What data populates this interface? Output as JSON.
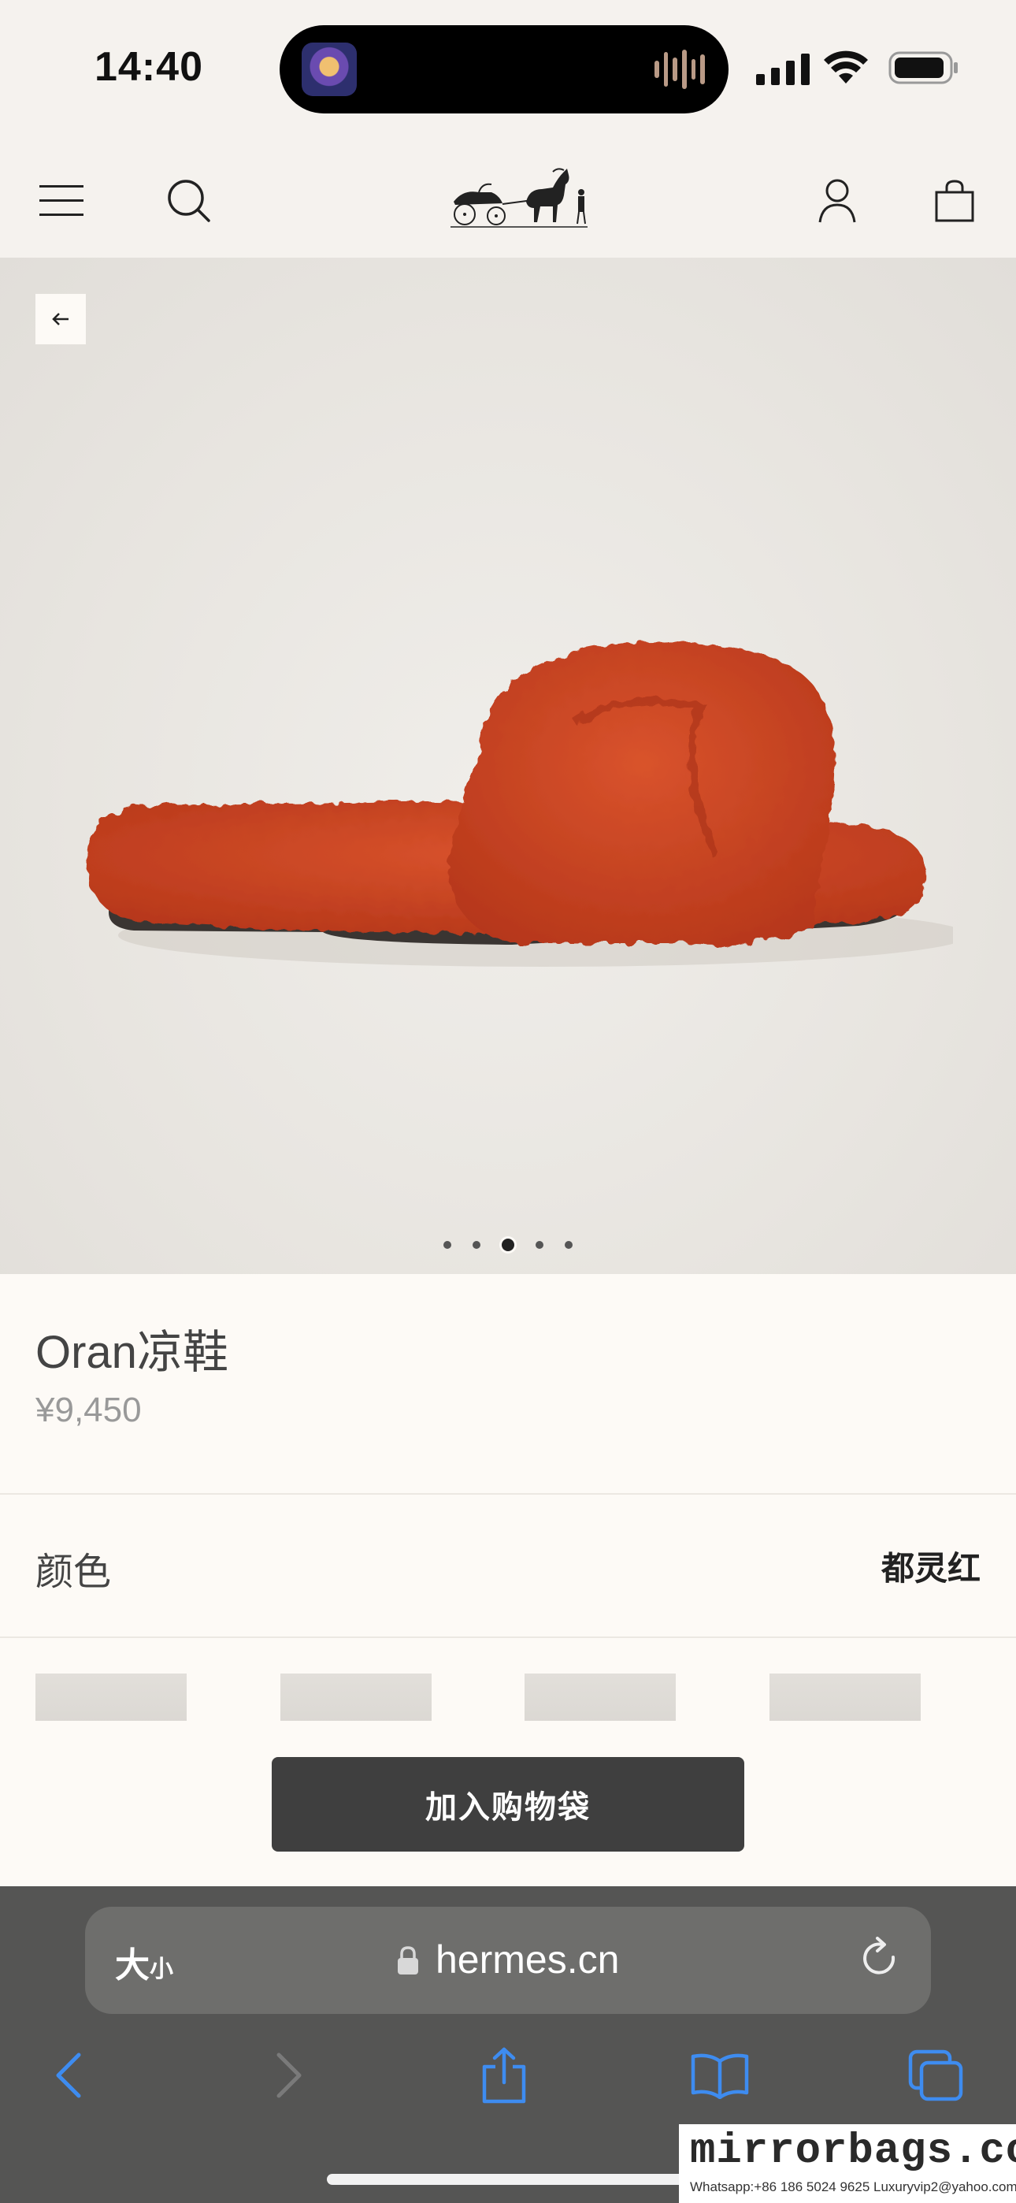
{
  "status_bar": {
    "time": "14:40",
    "now_playing_art_label": "MOONLIGHT"
  },
  "header": {
    "logo_name": "hermes-carriage-logo"
  },
  "product": {
    "name": "Oran凉鞋",
    "price": "¥9,450",
    "image_count": 5,
    "active_image_index": 2,
    "product_color_hex": "#c9401f"
  },
  "color_selector": {
    "label": "颜色",
    "value": "都灵红",
    "swatch_count": 4
  },
  "cta": {
    "label": "加入购物袋"
  },
  "browser": {
    "text_size_big": "大",
    "text_size_small": "小",
    "url": "hermes.cn",
    "accent_color": "#3e8cf0"
  },
  "watermark": {
    "main": "mirrorbags.com",
    "sub": "Whatsapp:+86 186 5024 9625   Luxuryvip2@yahoo.com"
  }
}
